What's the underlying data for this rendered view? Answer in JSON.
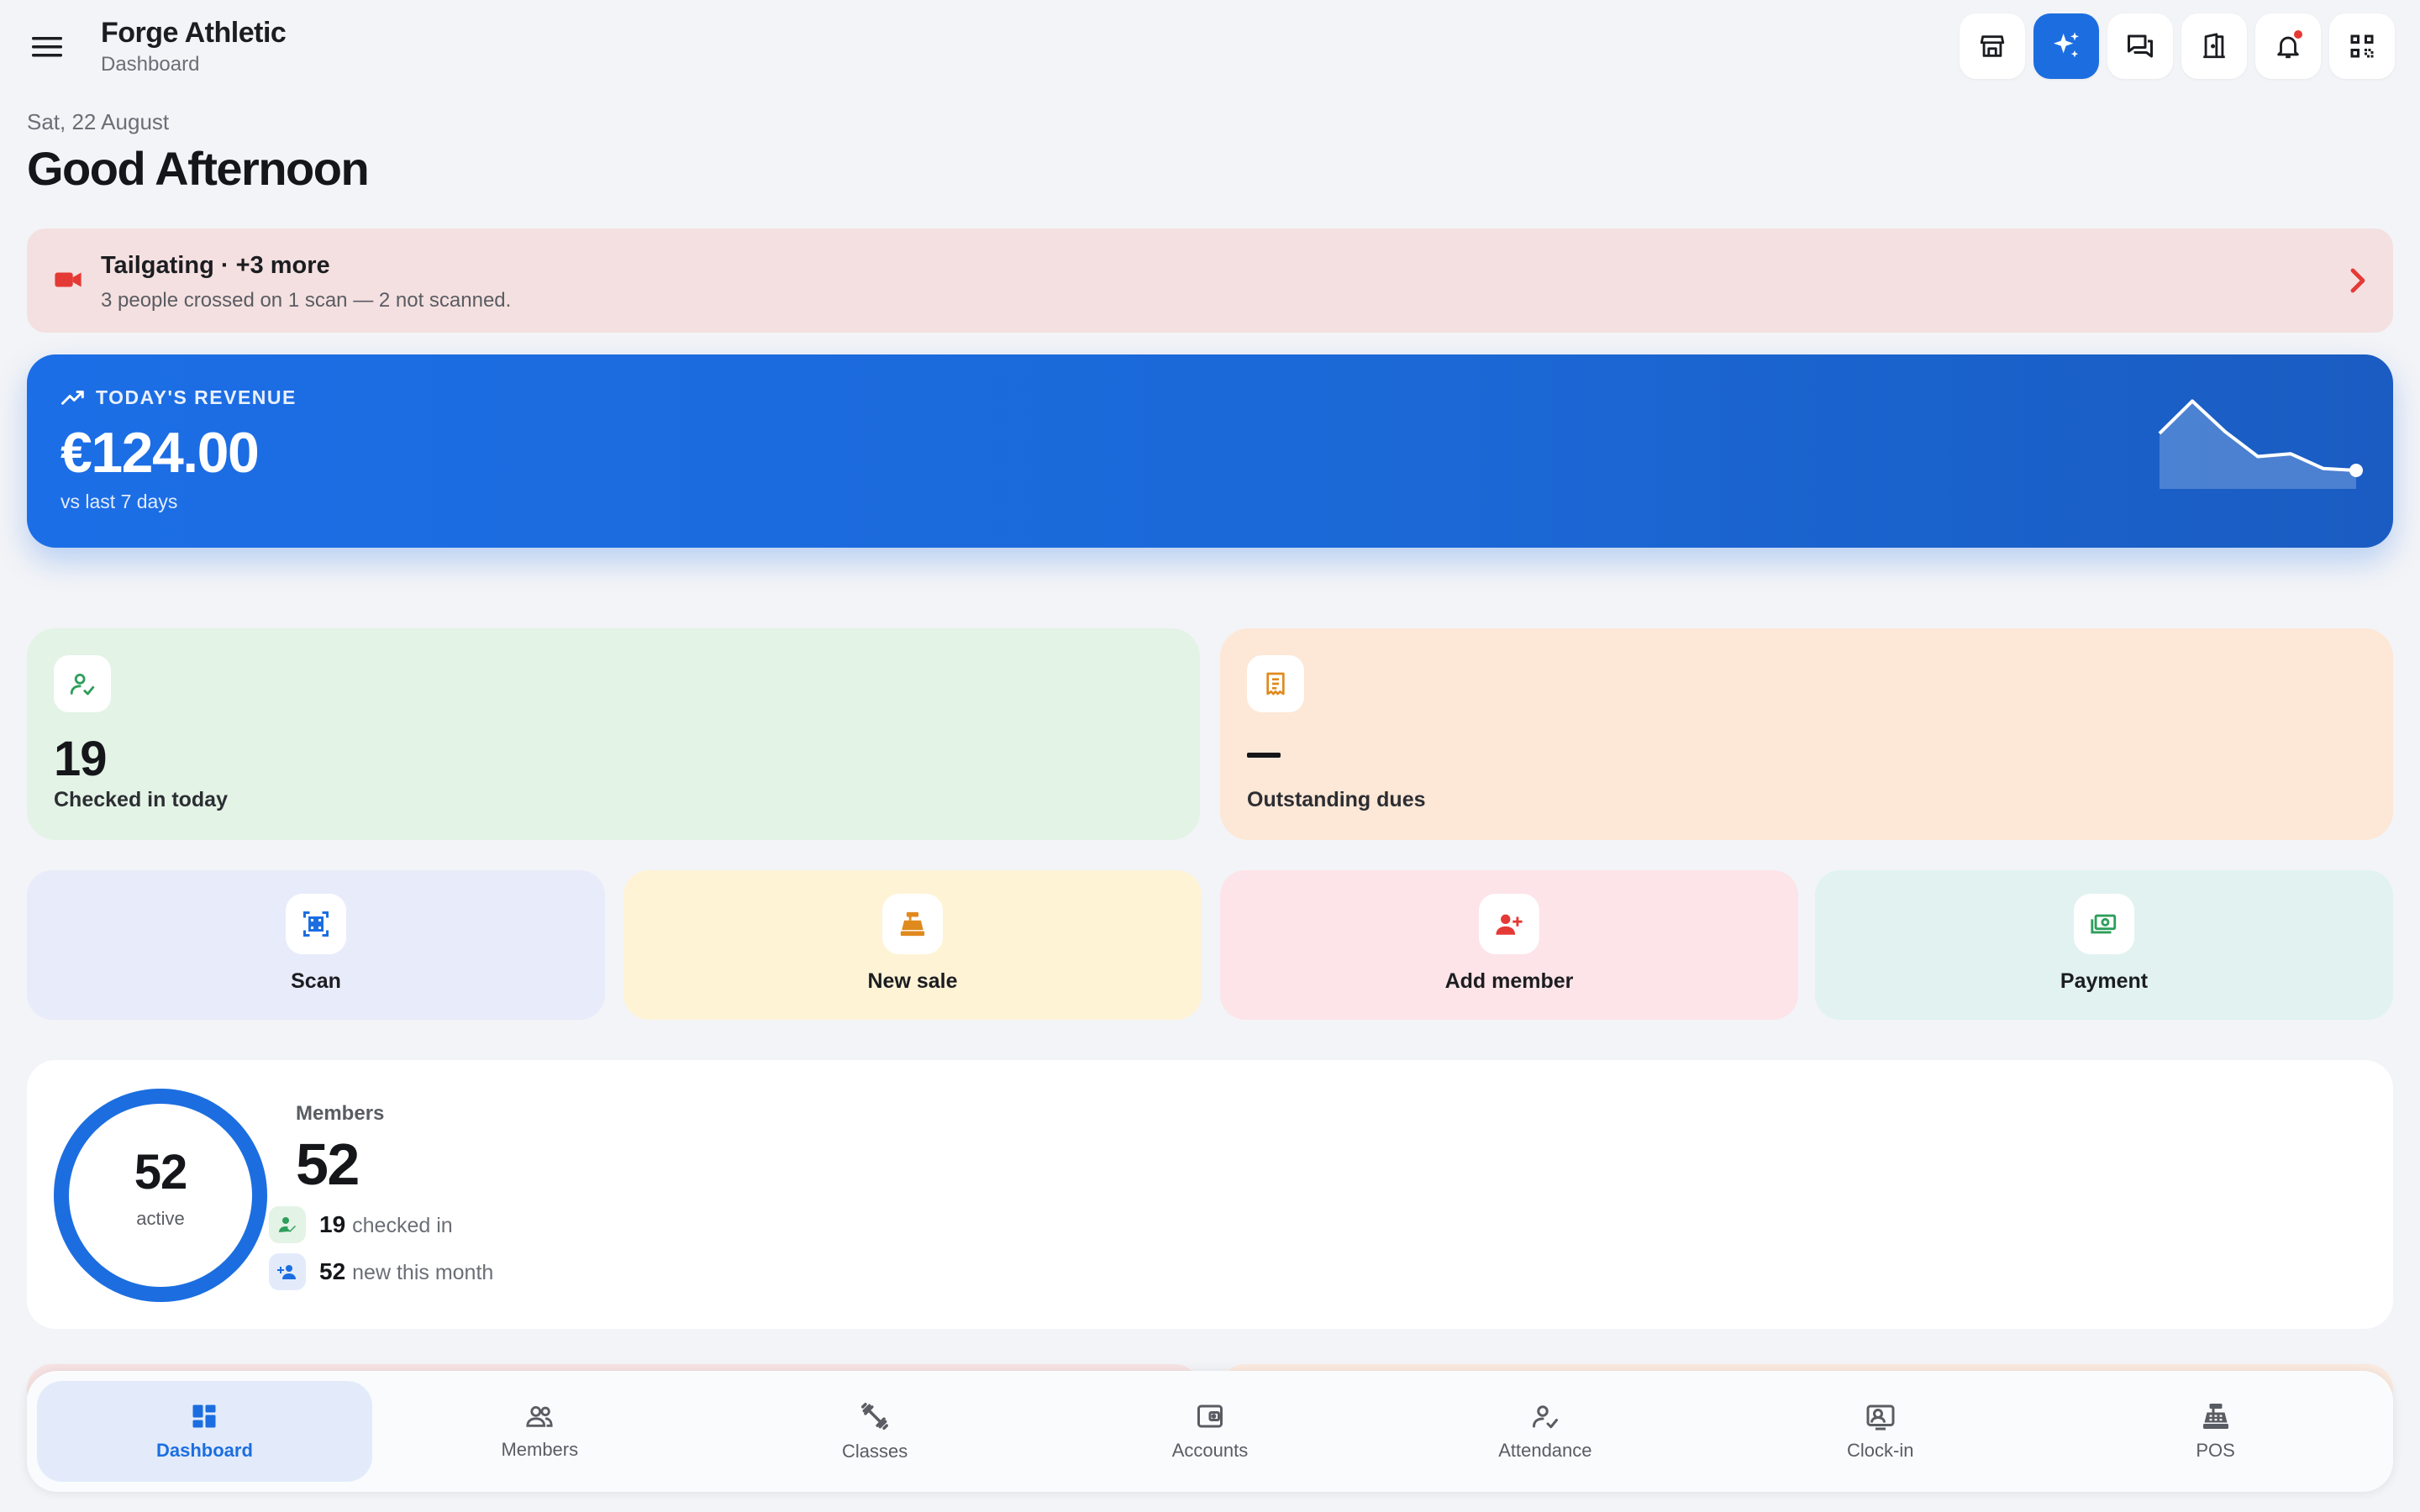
{
  "header": {
    "title": "Forge Athletic",
    "subtitle": "Dashboard",
    "actions": [
      {
        "icon": "storefront-icon"
      },
      {
        "icon": "sparkles-icon"
      },
      {
        "icon": "chat-icon"
      },
      {
        "icon": "door-icon"
      },
      {
        "icon": "bell-icon"
      },
      {
        "icon": "qr-code-icon"
      }
    ]
  },
  "greeting": {
    "date": "Sat, 22 August",
    "text": "Good Afternoon"
  },
  "alert": {
    "title": "Tailgating",
    "more": " · +3 more",
    "description": "3 people crossed on 1 scan — 2 not scanned.",
    "color": "#e53935"
  },
  "revenue": {
    "label": "TODAY'S REVENUE",
    "value": "€124.00",
    "subtitle": "vs last 7 days",
    "trend": [
      0.6,
      0.95,
      0.62,
      0.35,
      0.38,
      0.22,
      0.2
    ]
  },
  "stats": {
    "checked_in": {
      "value": "19",
      "label": "Checked in today"
    },
    "outstanding": {
      "value": "—",
      "label": "Outstanding dues"
    }
  },
  "quick_actions": [
    {
      "label": "Scan"
    },
    {
      "label": "New sale"
    },
    {
      "label": "Add member"
    },
    {
      "label": "Payment"
    }
  ],
  "members": {
    "title": "Members",
    "total": "52",
    "donut_value": "52",
    "donut_label": "active",
    "donut_fraction": 1.0,
    "checked_in_count": "19",
    "checked_in_label": "checked in",
    "new_count": "52",
    "new_label": "new this month"
  },
  "nav": [
    {
      "label": "Dashboard",
      "active": true
    },
    {
      "label": "Members"
    },
    {
      "label": "Classes"
    },
    {
      "label": "Accounts"
    },
    {
      "label": "Attendance"
    },
    {
      "label": "Clock-in"
    },
    {
      "label": "POS"
    }
  ],
  "colors": {
    "primary": "#1c6ee0",
    "success": "#2e9e5b",
    "warning": "#e08a1e",
    "danger": "#e53935"
  }
}
